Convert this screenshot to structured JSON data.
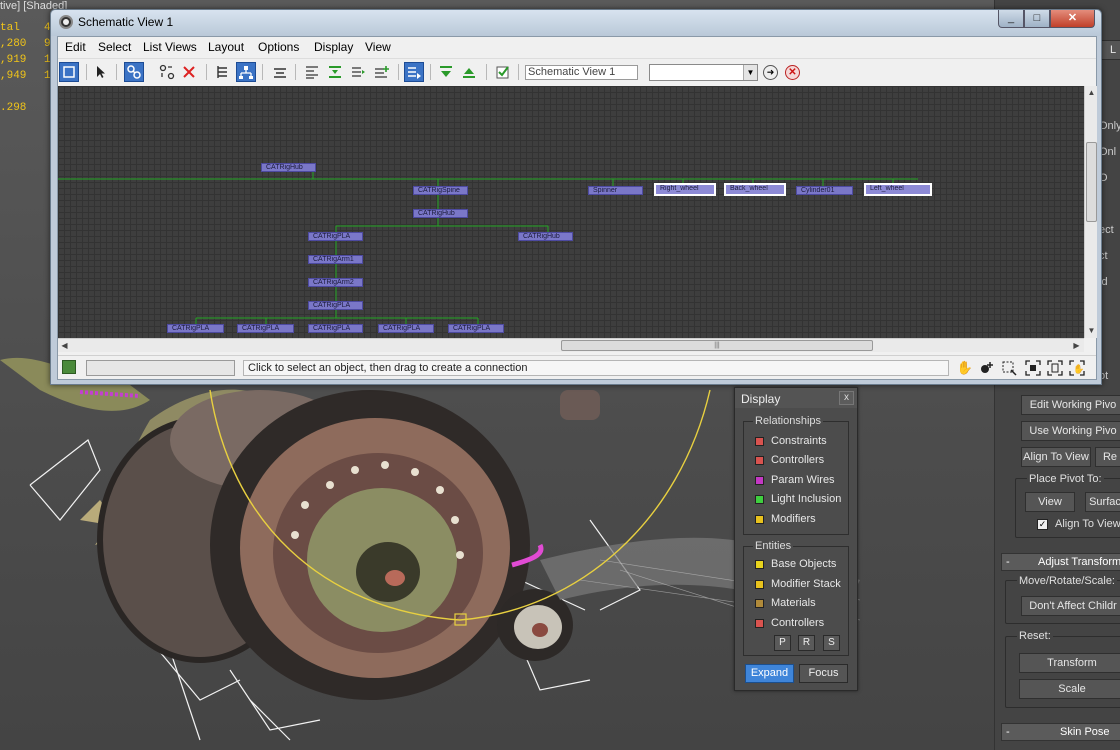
{
  "viewport": {
    "label": "tive] [Shaded]",
    "readouts": [
      {
        "label": "tal",
        "value": "4"
      },
      {
        "label": ",280",
        "value": "9"
      },
      {
        "label": ",919",
        "value": "1"
      },
      {
        "label": ",949",
        "value": "1"
      },
      {
        "label": "",
        "value": ""
      },
      {
        "label": ".298",
        "value": ""
      }
    ]
  },
  "window": {
    "title": "Schematic View 1",
    "minimize": "_",
    "maximize": "□",
    "close": "✕"
  },
  "menu": [
    "Edit",
    "Select",
    "List Views",
    "Layout",
    "Options",
    "Display",
    "View"
  ],
  "toolbar": {
    "view_name": "Schematic View 1",
    "view_select": "",
    "icons": [
      "display-floater",
      "select",
      "connect",
      "unlink",
      "delete",
      "hierarchy-mode",
      "references-mode",
      "move-children",
      "expand-selected",
      "collapse-selected",
      "select-children",
      "add-to-selection",
      "show-floater",
      "prev-selection",
      "next-selection",
      "sync-selection"
    ]
  },
  "schematic": {
    "nodes": [
      {
        "id": "n1",
        "label": "CATRigHub",
        "selected": false
      },
      {
        "id": "n2",
        "label": "CATRigSpine",
        "selected": false
      },
      {
        "id": "n3",
        "label": "CATRigHub",
        "selected": false
      },
      {
        "id": "n4",
        "label": "CATRigPLA",
        "selected": false
      },
      {
        "id": "n5",
        "label": "CATRigHub",
        "selected": false
      },
      {
        "id": "n6",
        "label": "CATRigArm1",
        "selected": false
      },
      {
        "id": "n7",
        "label": "CATRigArm2",
        "selected": false
      },
      {
        "id": "n8",
        "label": "CATRigPLA",
        "selected": false
      },
      {
        "id": "n9",
        "label": "CATRigPLA",
        "selected": false
      },
      {
        "id": "n10",
        "label": "CATRigPLA",
        "selected": false
      },
      {
        "id": "n11",
        "label": "CATRigPLA",
        "selected": false
      },
      {
        "id": "n12",
        "label": "CATRigPLA",
        "selected": false
      },
      {
        "id": "n13",
        "label": "CATRigPLA",
        "selected": false
      },
      {
        "id": "n14",
        "label": "Spinner",
        "selected": false
      },
      {
        "id": "n15",
        "label": "Right_wheel",
        "selected": true
      },
      {
        "id": "n16",
        "label": "Back_wheel",
        "selected": true
      },
      {
        "id": "n17",
        "label": "Cylinder01",
        "selected": false
      },
      {
        "id": "n18",
        "label": "Left_wheel",
        "selected": true
      }
    ],
    "hscroll_grip": "|||"
  },
  "status": {
    "field": "",
    "prompt": "Click to select an object, then drag to create a connection",
    "nav_icons": [
      "pan-icon",
      "zoom-icon",
      "zoom-region-icon",
      "zoom-extents-icon",
      "zoom-extents-selected-icon",
      "pan-hand-icon"
    ]
  },
  "display_panel": {
    "title": "Display",
    "close": "x",
    "relationships_title": "Relationships",
    "relationships": [
      {
        "label": "Constraints",
        "color": "#d9534f"
      },
      {
        "label": "Controllers",
        "color": "#d9534f"
      },
      {
        "label": "Param Wires",
        "color": "#c438c4"
      },
      {
        "label": "Light Inclusion",
        "color": "#3fcf3f"
      },
      {
        "label": "Modifiers",
        "color": "#e8c21d"
      }
    ],
    "entities_title": "Entities",
    "entities": [
      {
        "label": "Base Objects",
        "color": "#e8d31d"
      },
      {
        "label": "Modifier Stack",
        "color": "#e8c21d"
      },
      {
        "label": "Materials",
        "color": "#b08a3a"
      },
      {
        "label": "Controllers",
        "color": "#d9534f"
      }
    ],
    "p": "P",
    "r": "R",
    "s": "S",
    "expand": "Expand",
    "focus": "Focus"
  },
  "command_panel": {
    "top_btn": "L",
    "peek": [
      "t",
      "Only",
      "Onl",
      "O",
      "ect",
      "ct",
      "ld",
      "t",
      "ot"
    ],
    "edit_pivot": "Edit Working Pivo",
    "use_pivot": "Use Working Pivo",
    "align_to_view": "Align To View",
    "reset_peek": "Re",
    "place_pivot": "Place Pivot To:",
    "view": "View",
    "surface": "Surfac",
    "align_to_view_check": "Align To View",
    "adjust_transform": "Adjust Transform",
    "move_rotate_scale": "Move/Rotate/Scale:",
    "dont_affect_children": "Don't Affect Childr",
    "reset": "Reset:",
    "transform": "Transform",
    "scale": "Scale",
    "skin_pose": "Skin Pose",
    "rollout_minus": "-"
  }
}
